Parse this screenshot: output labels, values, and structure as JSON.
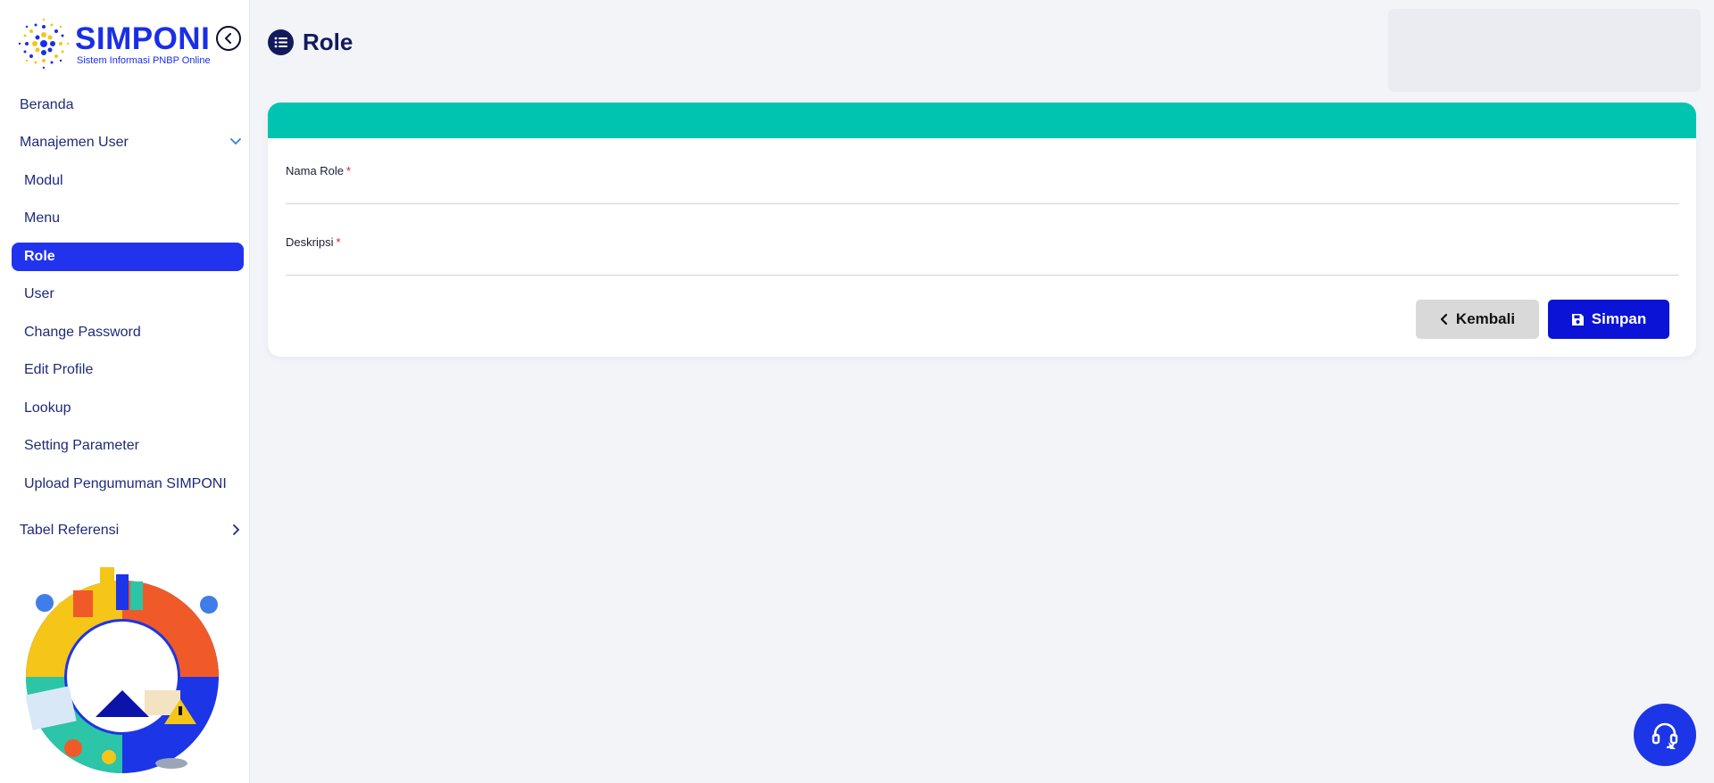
{
  "app": {
    "logo_title": "SIMPONI",
    "logo_subtitle": "Sistem Informasi PNBP Online",
    "brand_color": "#1a2ee8"
  },
  "sidebar": {
    "items": [
      {
        "label": "Beranda",
        "type": "link"
      },
      {
        "label": "Manajemen User",
        "type": "group",
        "expanded": true,
        "icon": "chevron-down-icon"
      },
      {
        "label": "Modul",
        "type": "sub"
      },
      {
        "label": "Menu",
        "type": "sub"
      },
      {
        "label": "Role",
        "type": "sub",
        "active": true
      },
      {
        "label": "User",
        "type": "sub"
      },
      {
        "label": "Change Password",
        "type": "sub"
      },
      {
        "label": "Edit Profile",
        "type": "sub"
      },
      {
        "label": "Lookup",
        "type": "sub"
      },
      {
        "label": "Setting Parameter",
        "type": "sub"
      },
      {
        "label": "Upload Pengumuman SIMPONI",
        "type": "sub"
      },
      {
        "label": "Tabel Referensi",
        "type": "group",
        "expanded": false,
        "icon": "chevron-right-icon"
      }
    ],
    "active_color": "#2233ee"
  },
  "page": {
    "title": "Role",
    "title_icon": "list-icon"
  },
  "form": {
    "header_color": "#00c4b0",
    "fields": [
      {
        "label": "Nama Role",
        "required_mark": "*",
        "value": ""
      },
      {
        "label": "Deskripsi",
        "required_mark": "*",
        "value": ""
      }
    ],
    "buttons": {
      "back_label": "Kembali",
      "save_label": "Simpan"
    }
  },
  "help": {
    "icon": "headset-icon"
  }
}
